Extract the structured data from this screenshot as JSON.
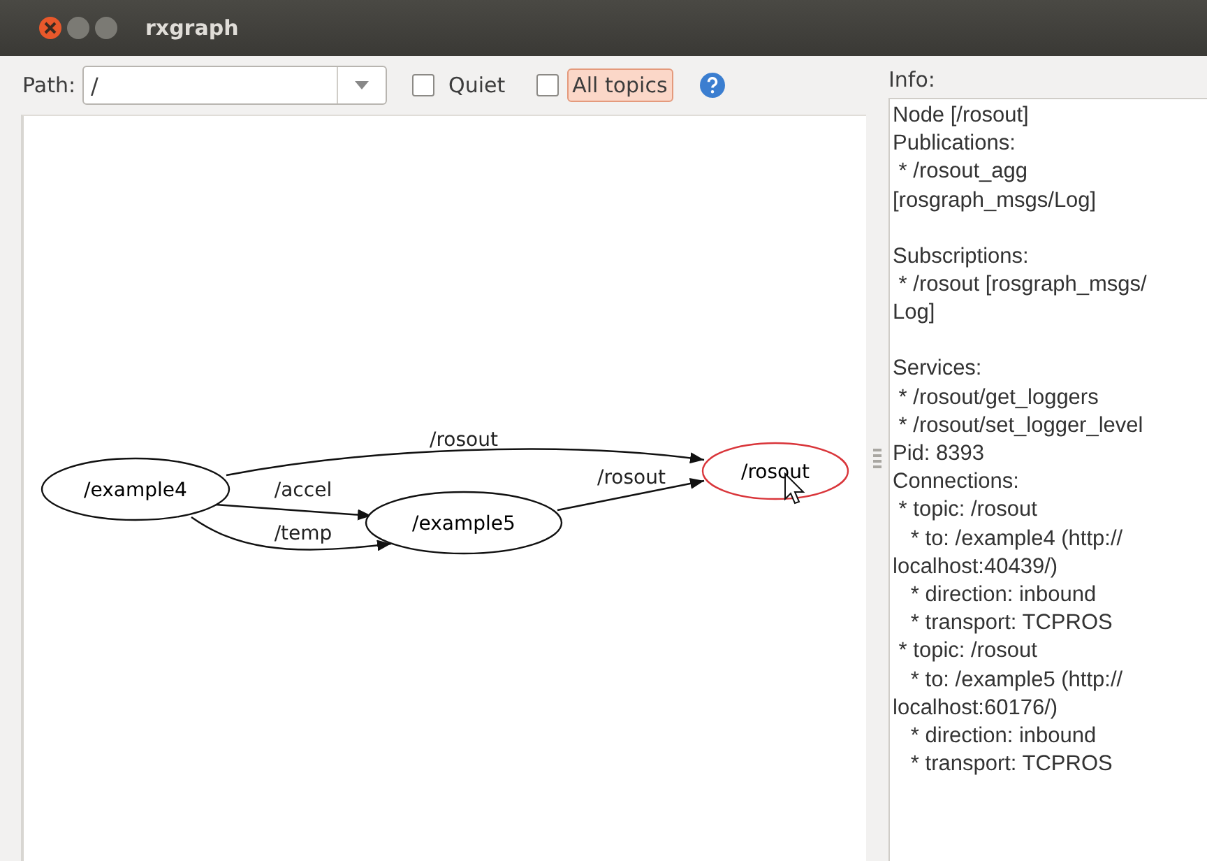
{
  "window": {
    "title": "rxgraph"
  },
  "toolbar": {
    "path_label": "Path:",
    "path_value": "/",
    "checkboxes": [
      {
        "label": "Quiet",
        "checked": false,
        "highlighted": false
      },
      {
        "label": "All topics",
        "checked": false,
        "highlighted": true
      }
    ]
  },
  "graph": {
    "nodes": [
      {
        "label": "/example4",
        "selected": false
      },
      {
        "label": "/example5",
        "selected": false
      },
      {
        "label": "/rosout",
        "selected": true
      }
    ],
    "edges": [
      {
        "label": "/rosout"
      },
      {
        "label": "/accel"
      },
      {
        "label": "/temp"
      },
      {
        "label": "/rosout"
      }
    ]
  },
  "info": {
    "label": "Info:",
    "blocks": [
      [
        "Node [/rosout]",
        "Publications:",
        " * /rosout_agg",
        "[rosgraph_msgs/Log]"
      ],
      [
        "Subscriptions:",
        " * /rosout [rosgraph_msgs/",
        "Log]"
      ],
      [
        "Services:",
        " * /rosout/get_loggers",
        " * /rosout/set_logger_level",
        "Pid: 8393",
        "Connections:",
        " * topic: /rosout",
        "   * to: /example4 (http://",
        "localhost:40439/)",
        "   * direction: inbound",
        "   * transport: TCPROS",
        " * topic: /rosout",
        "   * to: /example5 (http://",
        "localhost:60176/)",
        "   * direction: inbound",
        "   * transport: TCPROS"
      ]
    ]
  }
}
